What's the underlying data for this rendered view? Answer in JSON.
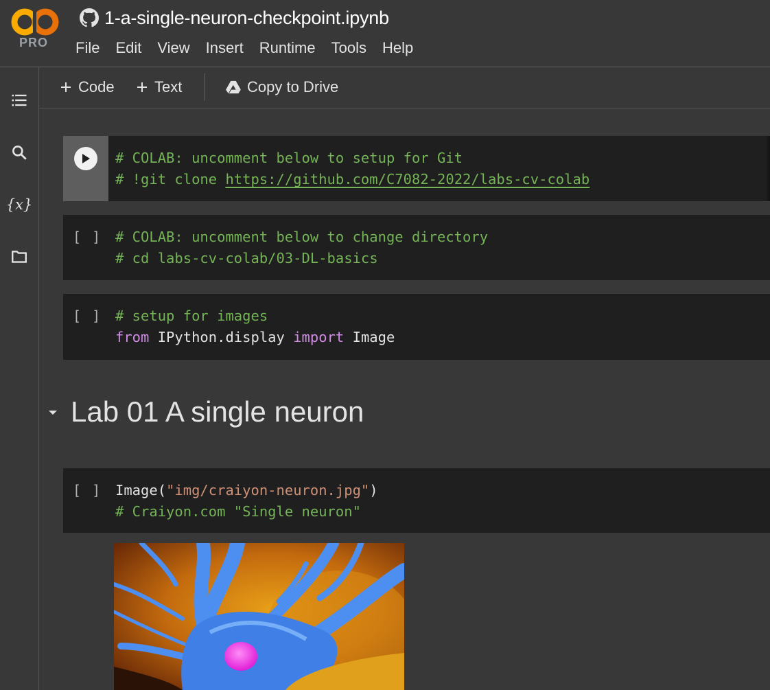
{
  "app": {
    "logo_badge": "PRO",
    "notebook_title": "1-a-single-neuron-checkpoint.ipynb",
    "title_icon": "github-icon"
  },
  "menu": [
    "File",
    "Edit",
    "View",
    "Insert",
    "Runtime",
    "Tools",
    "Help"
  ],
  "left_rail": [
    {
      "icon": "table-of-contents-icon"
    },
    {
      "icon": "search-icon"
    },
    {
      "icon": "variables-icon",
      "glyph": "{x}"
    },
    {
      "icon": "folder-icon"
    }
  ],
  "toolbar": {
    "add_code_label": "Code",
    "add_text_label": "Text",
    "copy_to_drive_label": "Copy to Drive"
  },
  "cells": [
    {
      "state": "run-button",
      "lines": [
        [
          {
            "t": "# COLAB: uncomment below to setup for Git",
            "k": "comment"
          }
        ],
        [
          {
            "t": "# !git clone ",
            "k": "comment"
          },
          {
            "t": "https://github.com/C7082-2022/labs-cv-colab",
            "k": "link"
          }
        ]
      ]
    },
    {
      "state": "[ ]",
      "lines": [
        [
          {
            "t": "# COLAB: uncomment below to change directory",
            "k": "comment"
          }
        ],
        [
          {
            "t": "# cd labs-cv-colab/03-DL-basics",
            "k": "comment"
          }
        ]
      ]
    },
    {
      "state": "[ ]",
      "lines": [
        [
          {
            "t": "# setup for images",
            "k": "comment"
          }
        ],
        [
          {
            "t": "from",
            "k": "kw"
          },
          {
            "t": " IPython.display ",
            "k": "plain"
          },
          {
            "t": "import",
            "k": "kw"
          },
          {
            "t": " Image",
            "k": "plain"
          }
        ]
      ]
    },
    {
      "state": "[ ]",
      "lines": [
        [
          {
            "t": "Image(",
            "k": "plain"
          },
          {
            "t": "\"img/craiyon-neuron.jpg\"",
            "k": "str"
          },
          {
            "t": ")",
            "k": "plain"
          }
        ],
        [
          {
            "t": "# Craiyon.com \"Single neuron\"",
            "k": "comment"
          }
        ]
      ]
    }
  ],
  "section": {
    "heading": "Lab 01 A single neuron"
  },
  "colors": {
    "background": "#383838",
    "cell_background": "#1f1f1f",
    "comment": "#74b456",
    "keyword": "#d28ae7",
    "string": "#ce9178",
    "logo_orange": "#F9AB00",
    "logo_dark_orange": "#E8710A"
  }
}
